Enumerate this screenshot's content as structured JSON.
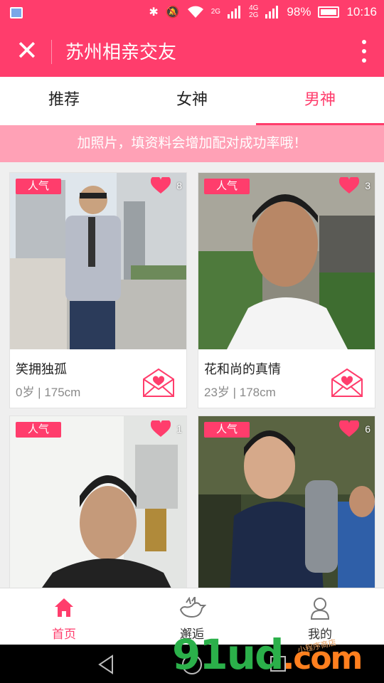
{
  "status_bar": {
    "network_label_top": "2G",
    "network_label_mid": "4G",
    "network_label_bot": "2G",
    "battery": "98%",
    "time": "10:16"
  },
  "header": {
    "title": "苏州相亲交友",
    "close_icon": "close-icon",
    "more_icon": "more-vertical-icon"
  },
  "tabs": [
    {
      "label": "推荐",
      "active": false
    },
    {
      "label": "女神",
      "active": false
    },
    {
      "label": "男神",
      "active": true
    }
  ],
  "notice": "加照片，填资料会增加配对成功率哦！",
  "cards": [
    {
      "badge": "人气",
      "likes": "8",
      "name": "笑拥独孤",
      "meta": "0岁 | 175cm"
    },
    {
      "badge": "人气",
      "likes": "3",
      "name": "花和尚的真情",
      "meta": "23岁 | 178cm"
    },
    {
      "badge": "人气",
      "likes": "1",
      "name": "",
      "meta": ""
    },
    {
      "badge": "人气",
      "likes": "6",
      "name": "",
      "meta": ""
    }
  ],
  "bottom_nav": [
    {
      "label": "首页",
      "icon": "home-icon",
      "active": true
    },
    {
      "label": "邂逅",
      "icon": "bird-icon",
      "active": false
    },
    {
      "label": "我的",
      "icon": "person-icon",
      "active": false
    }
  ],
  "watermark": {
    "main": "91ud",
    "suffix": ".com",
    "small": "小程序商店"
  },
  "colors": {
    "accent": "#ff3d6c",
    "notice_bg": "#ffa1b6",
    "meta_text": "#8a8a8a"
  }
}
